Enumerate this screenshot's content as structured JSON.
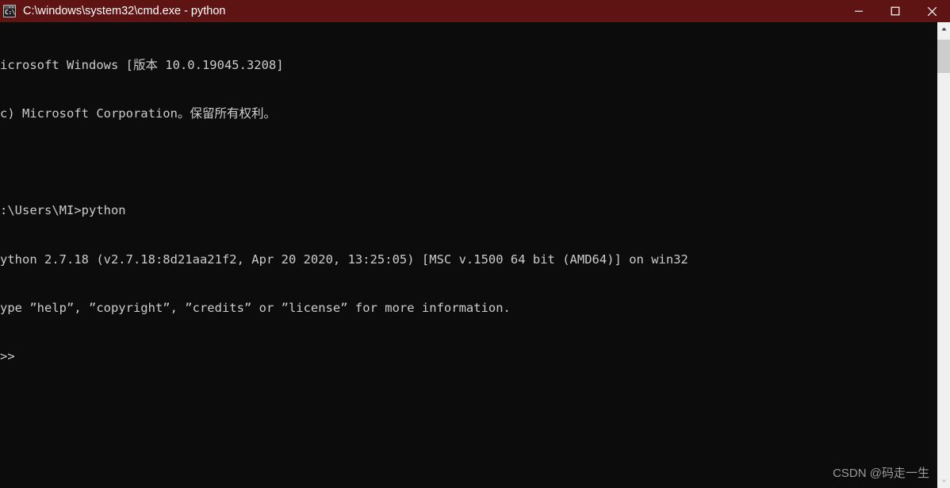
{
  "window": {
    "title": "C:\\windows\\system32\\cmd.exe - python",
    "icon": "cmd-console-icon",
    "title_bar_color": "#5f1414",
    "title_text_color": "#ffffff",
    "console_background": "#0c0c0c",
    "console_text_color": "#cccccc",
    "controls": [
      {
        "name": "minimize",
        "label": "Minimize",
        "glyph": "—"
      },
      {
        "name": "maximize",
        "label": "Maximize",
        "glyph": "☐"
      },
      {
        "name": "close",
        "label": "Close",
        "glyph": "✕"
      }
    ]
  },
  "console": {
    "lines": [
      "icrosoft Windows [版本 10.0.19045.3208]",
      "c) Microsoft Corporation。保留所有权利。",
      "",
      ":\\Users\\MI>python",
      "ython 2.7.18 (v2.7.18:8d21aa21f2, Apr 20 2020, 13:25:05) [MSC v.1500 64 bit (AMD64)] on win32",
      "ype ”help”, ”copyright”, ”credits” or ”license” for more information.",
      ">>"
    ]
  },
  "scrollbar": {
    "up_arrow": "scroll-up-arrow",
    "down_arrow": "scroll-down-arrow",
    "thumb": "scroll-thumb",
    "track_color": "#f0f0f0",
    "thumb_color": "#cdcdcd"
  },
  "watermark": {
    "text": "CSDN @码走一生",
    "color": "#9a9a9a"
  }
}
